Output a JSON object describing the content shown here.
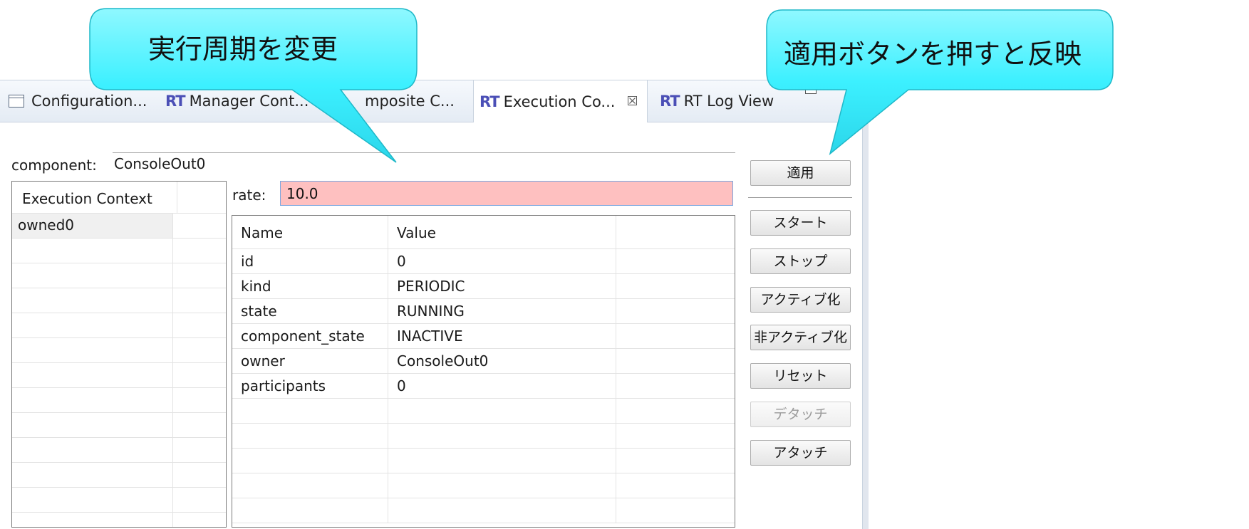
{
  "tabs": [
    {
      "label": "Configuration...",
      "icon": "configuration-view-icon"
    },
    {
      "label": "Manager Cont...",
      "icon": "rt-icon"
    },
    {
      "label": "mposite C...",
      "icon": "rt-icon"
    },
    {
      "label": "Execution Co...",
      "icon": "rt-icon",
      "active": true
    },
    {
      "label": "RT Log View",
      "icon": "rt-icon"
    }
  ],
  "rt_icon_text": "RT",
  "close_glyph": "☒",
  "component": {
    "label": "component:",
    "value": "ConsoleOut0"
  },
  "ec_list": {
    "header": "Execution Context",
    "items": [
      "owned0"
    ]
  },
  "rate": {
    "label": "rate:",
    "value": "10.0"
  },
  "properties": {
    "headers": {
      "name": "Name",
      "value": "Value"
    },
    "rows": [
      {
        "name": "id",
        "value": "0"
      },
      {
        "name": "kind",
        "value": "PERIODIC"
      },
      {
        "name": "state",
        "value": "RUNNING"
      },
      {
        "name": "component_state",
        "value": "INACTIVE"
      },
      {
        "name": "owner",
        "value": "ConsoleOut0"
      },
      {
        "name": "participants",
        "value": "0"
      }
    ]
  },
  "buttons": {
    "apply": "適用",
    "start": "スタート",
    "stop": "ストップ",
    "activate": "アクティブ化",
    "deactivate": "非アクティブ化",
    "reset": "リセット",
    "detach": "デタッチ",
    "attach": "アタッチ"
  },
  "callouts": {
    "left": "実行周期を変更",
    "right": "適用ボタンを押すと反映"
  },
  "colors": {
    "callout_fill": "#3cf0ff",
    "rate_invalid_bg": "#fec0c0",
    "rt_icon": "#4b4fb6"
  }
}
